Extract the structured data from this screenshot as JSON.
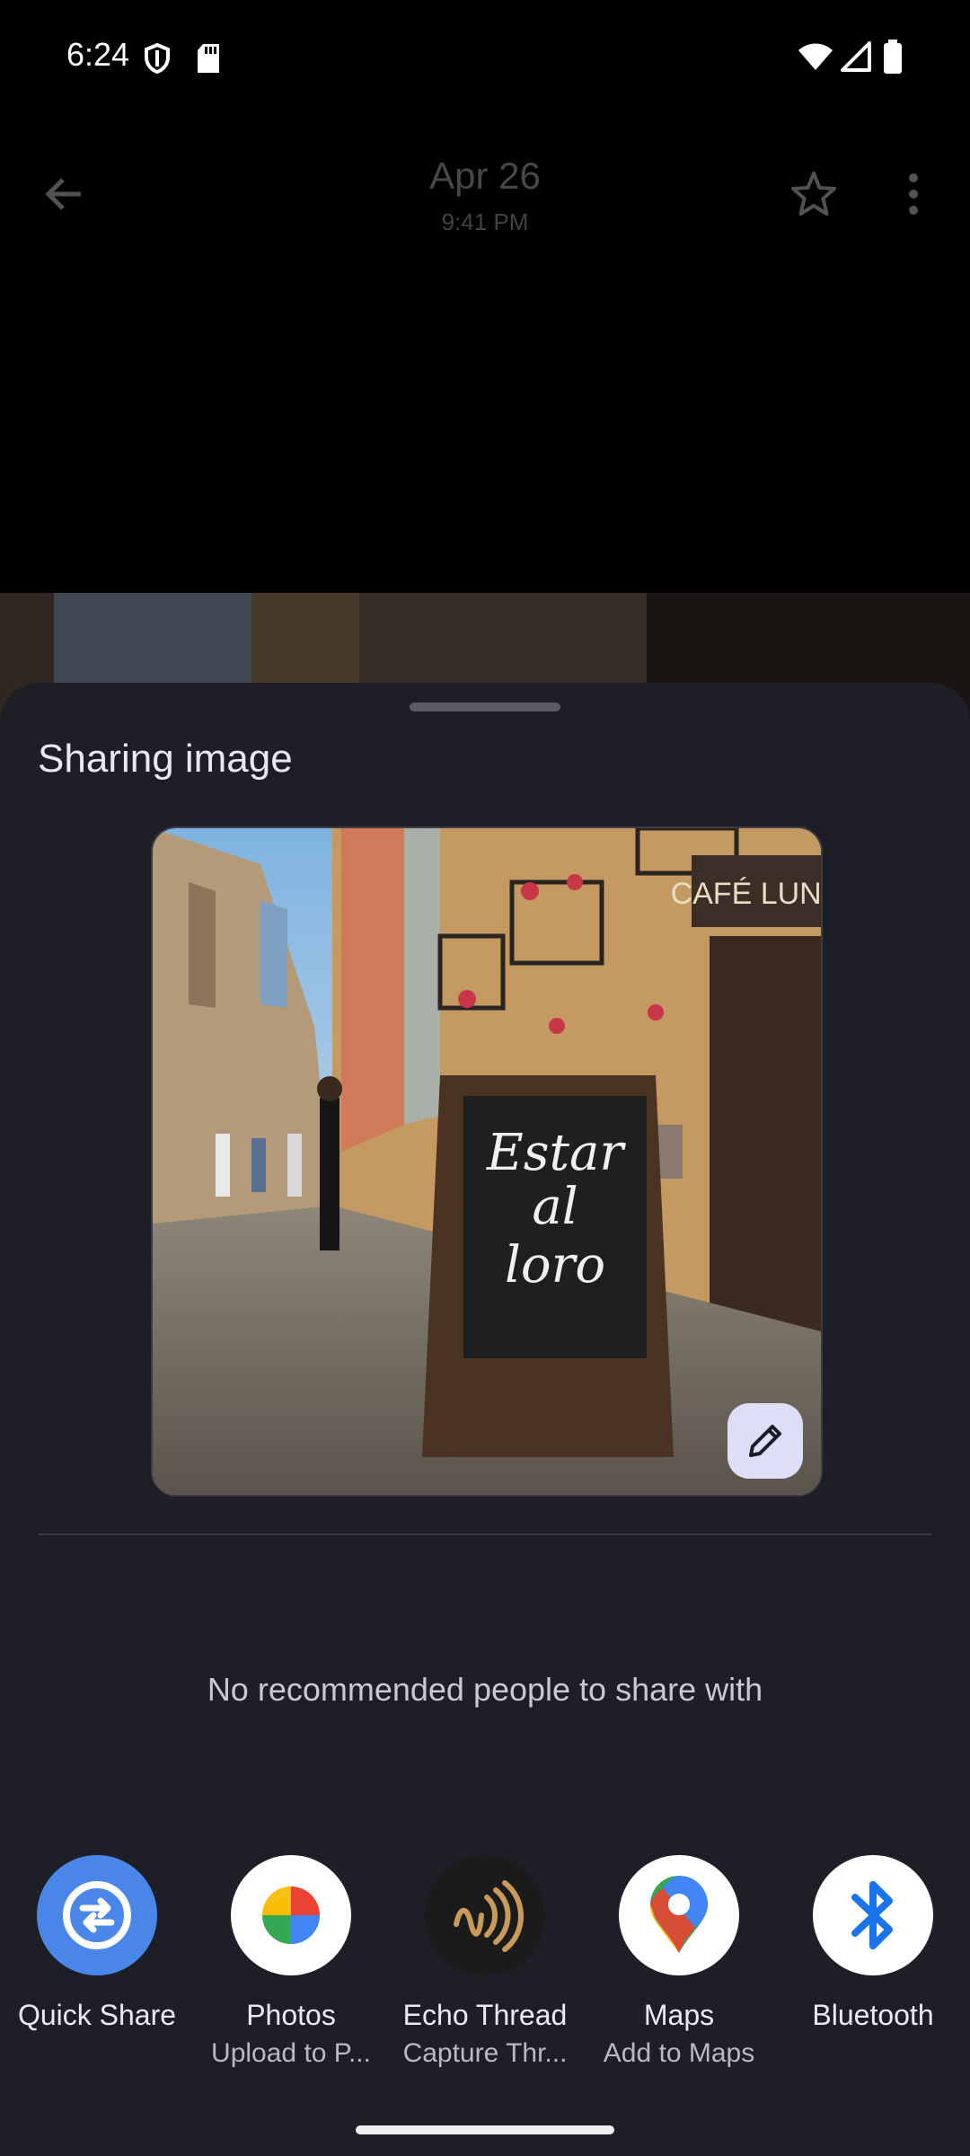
{
  "status_bar": {
    "time": "6:24",
    "icons": [
      "shield-icon",
      "sd-card-icon",
      "wifi-icon",
      "signal-icon",
      "battery-icon"
    ]
  },
  "background_app": {
    "date": "Apr 26",
    "time": "9:41 PM",
    "icons": [
      "back-arrow-icon",
      "star-icon",
      "more-vert-icon"
    ]
  },
  "share_sheet": {
    "title": "Sharing image",
    "preview_image": {
      "description_sign_text": "Estar al loro",
      "storefront_text": "CAFÉ LUNA"
    },
    "edit_icon": "pencil-icon",
    "empty_people_message": "No recommended people to share with",
    "targets": [
      {
        "name": "Quick Share",
        "subtitle": "",
        "icon": "quick-share-icon",
        "color": "#4a86e8"
      },
      {
        "name": "Photos",
        "subtitle": "Upload to P...",
        "icon": "photos-pinwheel-icon",
        "color": "#ffffff"
      },
      {
        "name": "Echo Thread",
        "subtitle": "Capture Thr...",
        "icon": "echo-thread-icon",
        "color": "#1b1b1b"
      },
      {
        "name": "Maps",
        "subtitle": "Add to Maps",
        "icon": "maps-pin-icon",
        "color": "#ffffff"
      },
      {
        "name": "Bluetooth",
        "subtitle": "",
        "icon": "bluetooth-icon",
        "color": "#ffffff"
      }
    ]
  },
  "colors": {
    "sheet_bg": "#1e1f26",
    "accent_blue": "#4a86e8"
  }
}
